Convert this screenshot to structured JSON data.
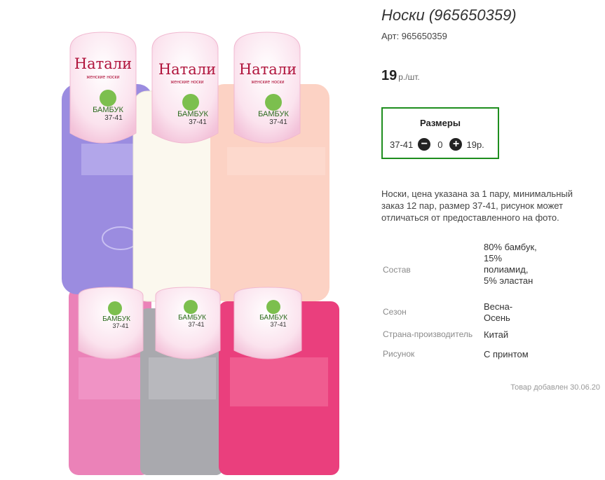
{
  "product": {
    "title": "Носки (965650359)",
    "article": "Арт: 965650359",
    "price": "19",
    "price_unit": "р./шт.",
    "image": {
      "brand": "Натали",
      "tagline": "женские носки",
      "material_badge": "БАМБУК",
      "size_badge": "37-41",
      "sock_colors": [
        "#9b8ce0",
        "#fbf8ee",
        "#fcd2c4",
        "#eb82b8",
        "#a9a9ae",
        "#ea3f7d"
      ]
    }
  },
  "sizes": {
    "title": "Размеры",
    "rows": [
      {
        "size": "37-41",
        "minus_icon": "minus-circle-icon",
        "qty": "0",
        "plus_icon": "plus-circle-icon",
        "price": "19р."
      }
    ]
  },
  "description": "Носки, цена указана за 1 пару, минимальный заказ 12 пар, размер 37-41, рисунок может отличаться от предоставленного на фото.",
  "specs": {
    "composition": {
      "label": "Состав",
      "value": "80% бамбук, 15% полиамид, 5% эластан"
    },
    "season": {
      "label": "Сезон",
      "value": "Весна-Осень"
    },
    "country": {
      "label": "Страна-производитель",
      "value": "Китай"
    },
    "pattern": {
      "label": "Рисунок",
      "value": "С принтом"
    }
  },
  "added_date": "Товар добавлен 30.06.20"
}
